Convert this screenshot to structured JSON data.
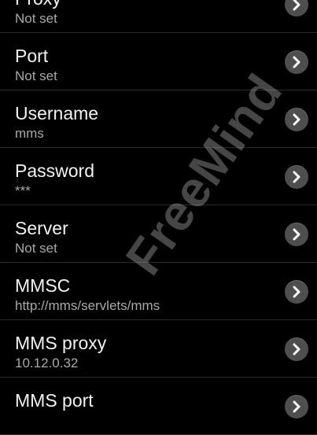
{
  "rows": [
    {
      "title": "Proxy",
      "value": "Not set"
    },
    {
      "title": "Port",
      "value": "Not set"
    },
    {
      "title": "Username",
      "value": "mms"
    },
    {
      "title": "Password",
      "value": "***"
    },
    {
      "title": "Server",
      "value": "Not set"
    },
    {
      "title": "MMSC",
      "value": "http://mms/servlets/mms"
    },
    {
      "title": "MMS proxy",
      "value": "10.12.0.32"
    },
    {
      "title": "MMS port",
      "value": ""
    }
  ],
  "watermark": "FreeMind",
  "icons": {
    "row_action": "chevron-right-icon"
  },
  "colors": {
    "background": "#000000",
    "title": "#f2f2f2",
    "value": "#a9a9a9",
    "chevron_bg": "#4e4e4e",
    "divider": "#2b2b2b"
  }
}
